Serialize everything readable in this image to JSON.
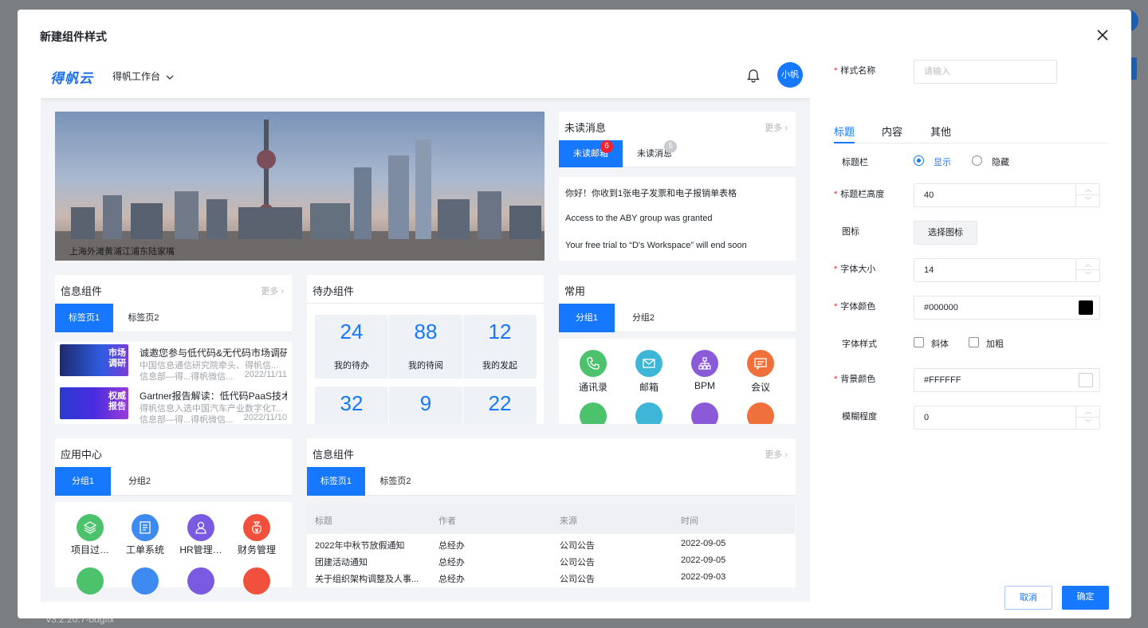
{
  "background": {
    "version": "v3.2.20.7-bugfix"
  },
  "modal": {
    "title": "新建组件样式"
  },
  "preview": {
    "header": {
      "logo": "得帆云",
      "workspace": "得帆工作台",
      "avatar": "小帆"
    },
    "banner": {
      "caption": "上海外滩黄浦江浦东陆家嘴"
    },
    "unread": {
      "title": "未读消息",
      "more": "更多 ›",
      "tabs": [
        {
          "label": "未读邮箱",
          "badge": "6"
        },
        {
          "label": "未读消息",
          "badge": "5"
        }
      ],
      "messages": [
        "你好！你收到1张电子发票和电子报销单表格",
        "Access to the ABY group was granted",
        "Your free trial to “D's Workspace” will end soon"
      ]
    },
    "info1": {
      "title": "信息组件",
      "more": "更多 ›",
      "tabs": [
        "标签页1",
        "标签页2"
      ],
      "items": [
        {
          "thumb": "市场调研",
          "title": "诚邀您参与低代码&无代码市场调研...",
          "summary": "中国信息通信研究院牵头、得帆信...",
          "source": "信息部—得...得帆微信...",
          "date": "2022/11/11"
        },
        {
          "thumb": "权威报告",
          "title": "Gartner报告解读：低代码PaaS技术...",
          "summary": "得帆信息入选中国汽车产业数字化T...",
          "source": "信息部—得...得帆微信...",
          "date": "2022/11/10"
        }
      ]
    },
    "todo": {
      "title": "待办组件",
      "cells": [
        {
          "num": "24",
          "label": "我的待办"
        },
        {
          "num": "88",
          "label": "我的待阅"
        },
        {
          "num": "12",
          "label": "我的发起"
        },
        {
          "num": "32",
          "label": ""
        },
        {
          "num": "9",
          "label": ""
        },
        {
          "num": "22",
          "label": ""
        }
      ]
    },
    "common": {
      "title": "常用",
      "tabs": [
        "分组1",
        "分组2"
      ],
      "apps": [
        {
          "label": "通讯录",
          "icon": "phone-icon",
          "color": "#4cc26c"
        },
        {
          "label": "邮箱",
          "icon": "mail-icon",
          "color": "#3db6d8"
        },
        {
          "label": "BPM",
          "icon": "org-chart-icon",
          "color": "#8a5ad8"
        },
        {
          "label": "会议",
          "icon": "chat-icon",
          "color": "#f0703c"
        }
      ]
    },
    "appcenter": {
      "title": "应用中心",
      "tabs": [
        "分组1",
        "分组2"
      ],
      "apps": [
        {
          "label": "项目过…",
          "icon": "layers-icon",
          "color": "#4cc26c"
        },
        {
          "label": "工单系统",
          "icon": "document-icon",
          "color": "#3d8af0"
        },
        {
          "label": "HR管理…",
          "icon": "user-icon",
          "color": "#7a5ae0"
        },
        {
          "label": "财务管理",
          "icon": "money-bag-icon",
          "color": "#f0503c"
        }
      ]
    },
    "info2": {
      "title": "信息组件",
      "more": "更多 ›",
      "tabs": [
        "标签页1",
        "标签页2"
      ],
      "columns": [
        "标题",
        "作者",
        "来源",
        "时间"
      ],
      "rows": [
        [
          "2022年中秋节放假通知",
          "总经办",
          "公司公告",
          "2022-09-05"
        ],
        [
          "团建活动通知",
          "总经办",
          "公司公告",
          "2022-09-05"
        ],
        [
          "关于组织架构调整及人事...",
          "总经办",
          "公司公告",
          "2022-09-03"
        ]
      ]
    }
  },
  "config": {
    "style_name_label": "样式名称",
    "style_name_placeholder": "请输入",
    "tabs": [
      "标题",
      "内容",
      "其他"
    ],
    "title_bar_label": "标题栏",
    "show_label": "显示",
    "hide_label": "隐藏",
    "title_height_label": "标题栏高度",
    "title_height_value": "40",
    "icon_label": "图标",
    "icon_button": "选择图标",
    "font_size_label": "字体大小",
    "font_size_value": "14",
    "font_color_label": "字体颜色",
    "font_color_value": "#000000",
    "font_style_label": "字体样式",
    "italic_label": "斜体",
    "bold_label": "加粗",
    "bg_color_label": "背景颜色",
    "bg_color_value": "#FFFFFF",
    "blur_label": "模糊程度",
    "blur_value": "0",
    "cancel": "取消",
    "confirm": "确定"
  },
  "colors": {
    "primary": "#1677ff",
    "danger": "#f5222d"
  }
}
